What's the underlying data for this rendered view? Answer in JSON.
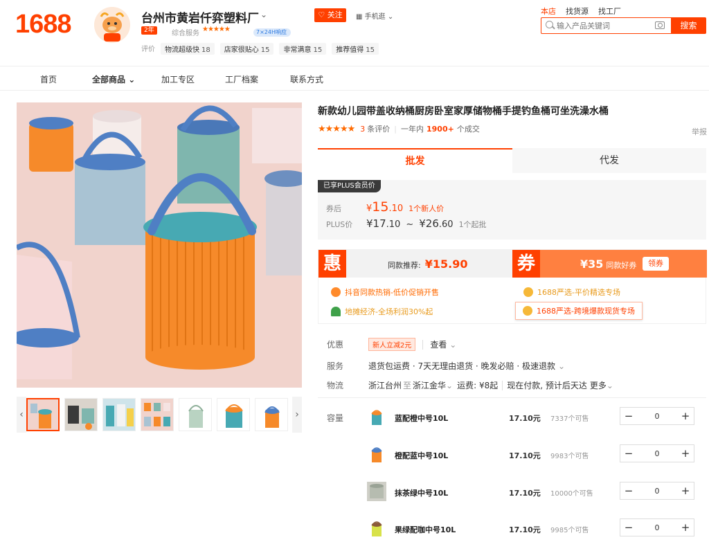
{
  "header": {
    "logo": "1688",
    "shop_name": "台州市黄岩仟弈塑料厂",
    "follow_label": "关注",
    "mobile_label": "手机逛",
    "year_badge": "2年",
    "service_label": "综合服务",
    "service_stars": "★★★★★",
    "response_badge": "7×24H响应",
    "eval_label": "评价",
    "eval_items": [
      {
        "label": "物流超级快",
        "count": "18"
      },
      {
        "label": "店家很贴心",
        "count": "15"
      },
      {
        "label": "非常满意",
        "count": "15"
      },
      {
        "label": "推荐值得",
        "count": "15"
      }
    ],
    "scope_tabs": [
      "本店",
      "找货源",
      "找工厂"
    ],
    "search_placeholder": "输入产品关键词",
    "search_button": "搜索"
  },
  "nav": {
    "items": [
      "首页",
      "全部商品",
      "加工专区",
      "工厂档案",
      "联系方式"
    ]
  },
  "gallery": {
    "thumb_count": 7
  },
  "product": {
    "title": "新款幼儿园带盖收纳桶厨房卧室家厚储物桶手提钓鱼桶可坐洗澡水桶",
    "stars": "★★★★★",
    "review_count": "3",
    "review_label": "条评价",
    "period_label": "一年内",
    "sold_count": "1900+",
    "sold_label": "个成交",
    "report_label": "举报",
    "tab_wholesale": "批发",
    "tab_dropship": "代发",
    "plus_badge": "已享PLUS会员价",
    "coupon_price_label": "券后",
    "coupon_price_yen": "¥",
    "coupon_price_int": "15",
    "coupon_price_dec": ".10",
    "coupon_price_note": "1个新人价",
    "plus_price_label": "PLUS价",
    "plus_price_low_int": "¥17",
    "plus_price_low_dec": ".10",
    "plus_price_sep": "~",
    "plus_price_high_int": "¥26",
    "plus_price_high_dec": ".60",
    "plus_price_note": "1个起批"
  },
  "promo": {
    "hui_icon": "惠",
    "hui_label": "同款推荐:",
    "hui_price": "¥15.90",
    "quan_icon": "券",
    "quan_amount": "¥35",
    "quan_label": "同款好券",
    "quan_button": "领券",
    "links": [
      "抖音同款热销-低价促销开售",
      "1688严选-平价精选专场",
      "地摊经济-全场利润30%起",
      "1688严选-跨境爆款现货专场"
    ]
  },
  "info": {
    "discount_label": "优惠",
    "discount_tag": "新人立减2元",
    "discount_more": "查看",
    "service_label": "服务",
    "service_text": "退货包运费 · 7天无理由退货 · 晚发必赔 · 极速退款",
    "logistics_label": "物流",
    "logistics_from": "浙江台州",
    "logistics_to_word": "至",
    "logistics_to": "浙江金华",
    "logistics_fee": "运费: ¥8起",
    "logistics_eta": "现在付款, 预计后天达",
    "logistics_more": "更多"
  },
  "sku": {
    "label": "容量",
    "items": [
      {
        "name": "蓝配橙中号10L",
        "price": "17.10元",
        "stock": "7337个可售",
        "qty": "0",
        "minus": "−",
        "plus": "+"
      },
      {
        "name": "橙配蓝中号10L",
        "price": "17.10元",
        "stock": "9983个可售",
        "qty": "0",
        "minus": "−",
        "plus": "+"
      },
      {
        "name": "抹茶绿中号10L",
        "price": "17.10元",
        "stock": "10000个可售",
        "qty": "0",
        "minus": "−",
        "plus": "+"
      },
      {
        "name": "果绿配咖中号10L",
        "price": "17.10元",
        "stock": "9985个可售",
        "qty": "0",
        "minus": "−",
        "plus": "+"
      }
    ]
  },
  "colors": {
    "brand": "#ff4000",
    "accent_orange": "#ff8040",
    "bucket_orange": "#f68a2a",
    "bucket_blue": "#4f7fc4",
    "bucket_teal": "#47a9b3",
    "background_pink": "#f1d3cc"
  }
}
